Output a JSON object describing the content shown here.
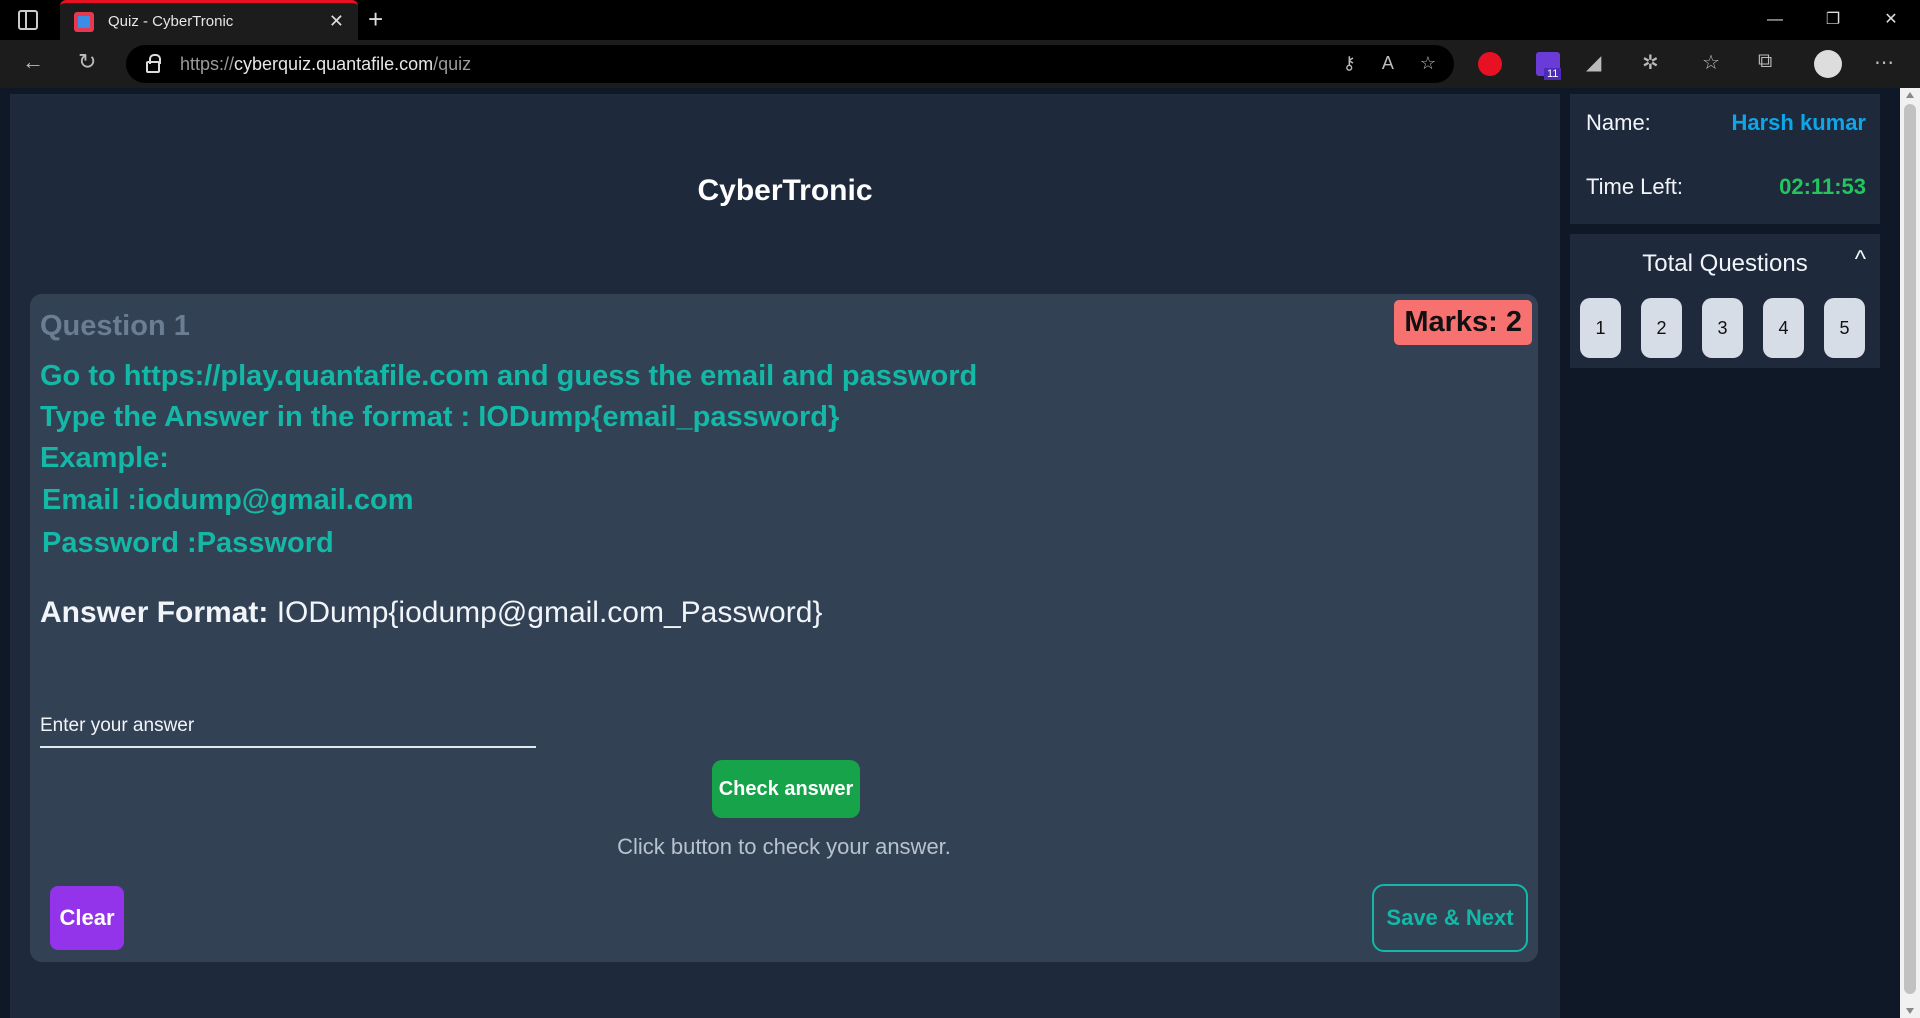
{
  "browser": {
    "tab_title": "Quiz - CyberTronic",
    "new_tab_icon": "+",
    "url_scheme": "https://",
    "url_host": "cyberquiz.quantafile.com",
    "url_path": "/quiz",
    "extension_badge": "11"
  },
  "page": {
    "title": "CyberTronic"
  },
  "question": {
    "label": "Question 1",
    "marks": "Marks: 2",
    "lines": [
      "Go to https://play.quantafile.com and guess the email and password",
      "Type the Answer in the format : IODump{email_password}",
      "Example:",
      "Email :iodump@gmail.com",
      "Password :Password"
    ],
    "answer_format_label": "Answer Format:",
    "answer_format_value": "IODump{iodump@gmail.com_Password}",
    "answer_placeholder": "Enter your answer",
    "answer_value": "",
    "check_button": "Check answer",
    "check_hint": "Click button to check your answer.",
    "clear_button": "Clear",
    "save_next_button": "Save & Next"
  },
  "sidebar": {
    "name_label": "Name:",
    "name_value": "Harsh kumar",
    "time_label": "Time Left:",
    "time_value": "02:11:53",
    "total_questions_label": "Total Questions",
    "toggle_icon": "chevron-up-icon",
    "question_numbers": [
      "1",
      "2",
      "3",
      "4",
      "5"
    ]
  },
  "colors": {
    "question_text": "#14b8a6",
    "marks_bg": "#f87171",
    "check_button_bg": "#16a34a",
    "clear_button_bg": "#9333ea",
    "name_value": "#0ea5e9",
    "time_value": "#22c55e"
  }
}
